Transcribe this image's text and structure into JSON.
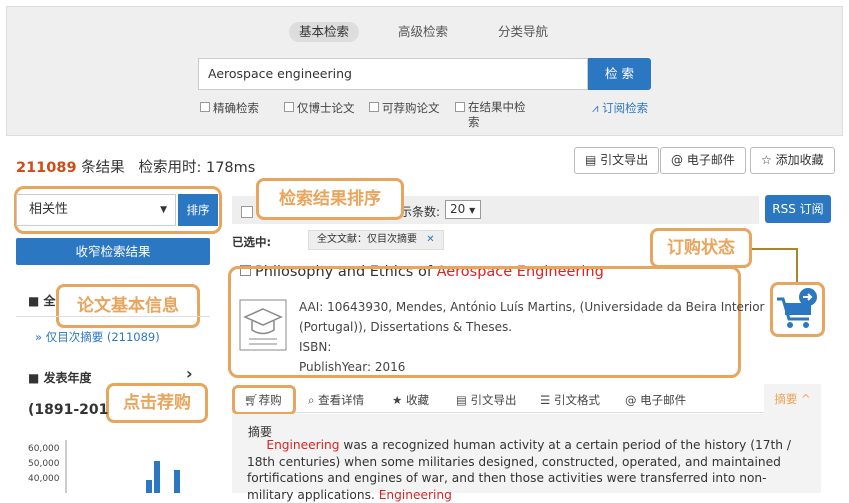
{
  "tabs": [
    "基本检索",
    "高级检索",
    "分类导航"
  ],
  "search": {
    "value": "Aerospace engineering",
    "button": "检 索"
  },
  "options": [
    "精确检索",
    "仅博士论文",
    "可荐购论文",
    "在结果中检\n索"
  ],
  "rss_link": "订阅检索",
  "results": {
    "count": "211089",
    "count_label": "条结果",
    "time_label": "检索用时:",
    "time_value": "178ms"
  },
  "toolbar": [
    "引文导出",
    "电子邮件",
    "添加收藏"
  ],
  "sort": {
    "selected": "相关性",
    "button": "排序"
  },
  "narrow_button": "收窄检索结果",
  "page_size": {
    "label": "示条数:",
    "value": "20"
  },
  "rss_button": "RSS 订阅",
  "selected": {
    "label": "已选中:",
    "tag": "全文文献：仅目次摘要"
  },
  "callouts": {
    "sort": "检索结果排序",
    "order_status": "订购状态",
    "paper_info": "论文基本信息",
    "click_buy": "点击荐购"
  },
  "record": {
    "title_prefix": "Philosophy and Ethics of ",
    "title_hl": "Aerospace Engineering",
    "line1": "AAI: 10643930, Mendes, António Luís Martins, (Universidade da Beira Interior",
    "line2": "(Portugal)), Dissertations & Theses.",
    "isbn": "ISBN:",
    "year": "PublishYear: 2016"
  },
  "facet": {
    "heading_partial": "全",
    "item": "» 仅目次摘要  (211089)",
    "year_heading": "发表年度",
    "year_range": "(1891-201"
  },
  "chart_data": {
    "type": "bar",
    "yticks": [
      "60,000",
      "50,000",
      "40,000"
    ]
  },
  "actions": [
    "荐购",
    "查看详情",
    "收藏",
    "引文导出",
    "引文格式",
    "电子邮件",
    "摘要 ^"
  ],
  "abstract": {
    "label": "摘要",
    "hl": "Engineering",
    "text": " was a recognized human activity at a certain period of the history (17th / 18th centuries) when some militaries designed, constructed, operated, and maintained fortifications and engines of war, and then those activities were transferred into non-military applications. ",
    "hl2": "Engineering"
  }
}
